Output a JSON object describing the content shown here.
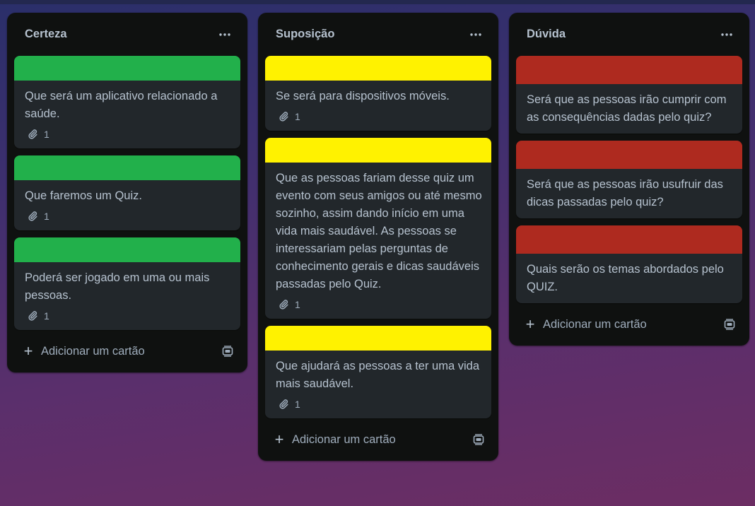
{
  "colors": {
    "green": "#22b04b",
    "yellow": "#fff200",
    "red": "#ae2a1f"
  },
  "lists": [
    {
      "title": "Certeza",
      "menu_icon": "more-icon",
      "cards": [
        {
          "cover": "green",
          "text": "Que será um aplicativo relacionado a saúde.",
          "attachments": "1"
        },
        {
          "cover": "green",
          "text": "Que faremos um Quiz.",
          "attachments": "1"
        },
        {
          "cover": "green",
          "text": "Poderá ser jogado em uma ou mais pessoas.",
          "attachments": "1"
        }
      ],
      "add_card_label": "Adicionar um cartão"
    },
    {
      "title": "Suposição",
      "menu_icon": "more-icon",
      "cards": [
        {
          "cover": "yellow",
          "text": "Se será para dispositivos móveis.",
          "attachments": "1"
        },
        {
          "cover": "yellow",
          "text": "Que as pessoas fariam desse quiz um evento com seus amigos ou até mesmo sozinho, assim dando início em uma vida mais saudável. As pessoas se interessariam pelas perguntas de conhecimento gerais e dicas saudáveis passadas pelo Quiz.",
          "attachments": "1"
        },
        {
          "cover": "yellow",
          "text": "Que ajudará as pessoas a ter uma vida mais saudável.",
          "attachments": "1"
        }
      ],
      "add_card_label": "Adicionar um cartão"
    },
    {
      "title": "Dúvida",
      "menu_icon": "more-icon",
      "cards": [
        {
          "cover": "red",
          "text": "Será que as pessoas irão cumprir com as consequências dadas pelo quiz?"
        },
        {
          "cover": "red",
          "text": "Será que as pessoas irão usufruir das dicas passadas pelo quiz?"
        },
        {
          "cover": "red",
          "text": "Quais serão os temas abordados pelo QUIZ."
        }
      ],
      "add_card_label": "Adicionar um cartão"
    }
  ]
}
